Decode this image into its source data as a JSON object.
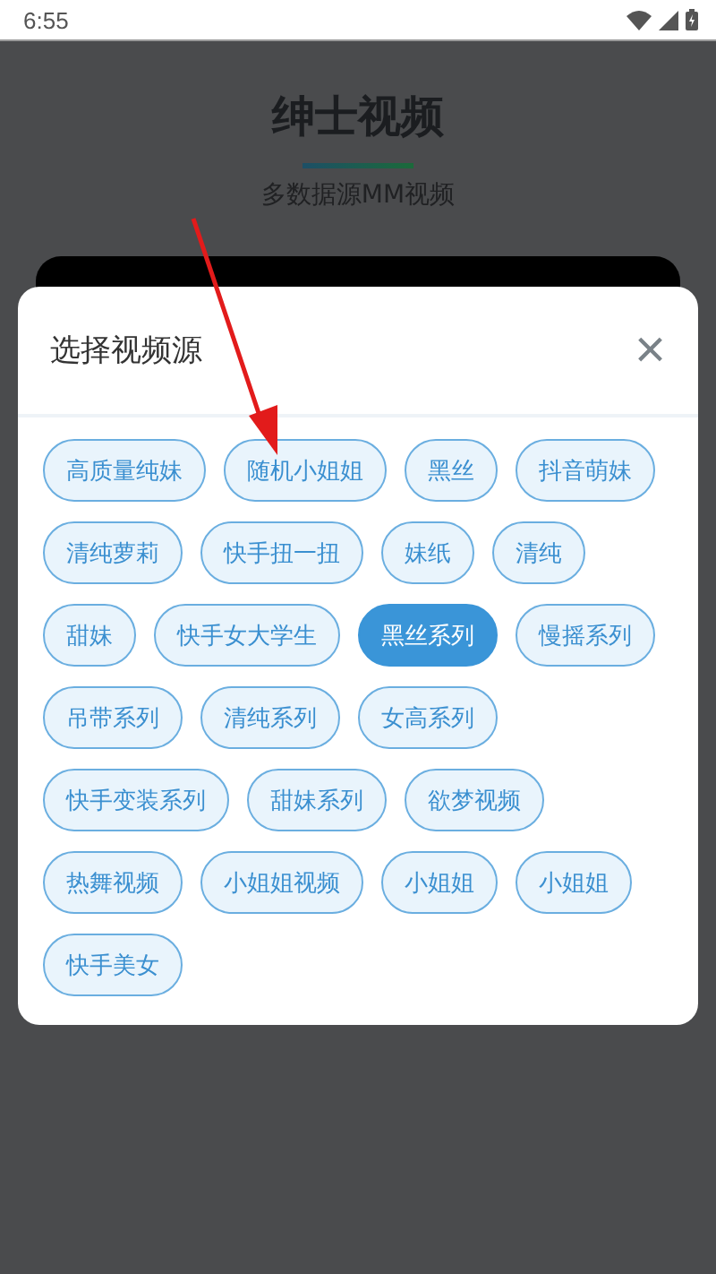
{
  "status_bar": {
    "time": "6:55"
  },
  "page": {
    "title": "绅士视频",
    "subtitle": "多数据源MM视频"
  },
  "dialog": {
    "title": "选择视频源",
    "close": "×",
    "rows": [
      {
        "sources": [
          {
            "label": "高质量纯妹",
            "selected": false
          },
          {
            "label": "随机小姐姐",
            "selected": false
          },
          {
            "label": "黑丝",
            "selected": false
          },
          {
            "label": "抖音萌妹",
            "selected": false
          }
        ]
      },
      {
        "sources": [
          {
            "label": "清纯萝莉",
            "selected": false
          },
          {
            "label": "快手扭一扭",
            "selected": false
          },
          {
            "label": "妹纸",
            "selected": false
          },
          {
            "label": "清纯",
            "selected": false
          }
        ]
      },
      {
        "sources": [
          {
            "label": "甜妹",
            "selected": false
          },
          {
            "label": "快手女大学生",
            "selected": false
          },
          {
            "label": "黑丝系列",
            "selected": true
          },
          {
            "label": "慢摇系列",
            "selected": false
          }
        ]
      },
      {
        "sources": [
          {
            "label": "吊带系列",
            "selected": false
          },
          {
            "label": "清纯系列",
            "selected": false
          },
          {
            "label": "女高系列",
            "selected": false
          }
        ]
      },
      {
        "sources": [
          {
            "label": "快手变装系列",
            "selected": false
          },
          {
            "label": "甜妹系列",
            "selected": false
          },
          {
            "label": "欲梦视频",
            "selected": false
          }
        ]
      },
      {
        "sources": [
          {
            "label": "热舞视频",
            "selected": false
          },
          {
            "label": "小姐姐视频",
            "selected": false
          },
          {
            "label": "小姐姐",
            "selected": false
          },
          {
            "label": "小姐姐",
            "selected": false
          }
        ]
      },
      {
        "sources": [
          {
            "label": "快手美女",
            "selected": false
          }
        ]
      }
    ]
  }
}
